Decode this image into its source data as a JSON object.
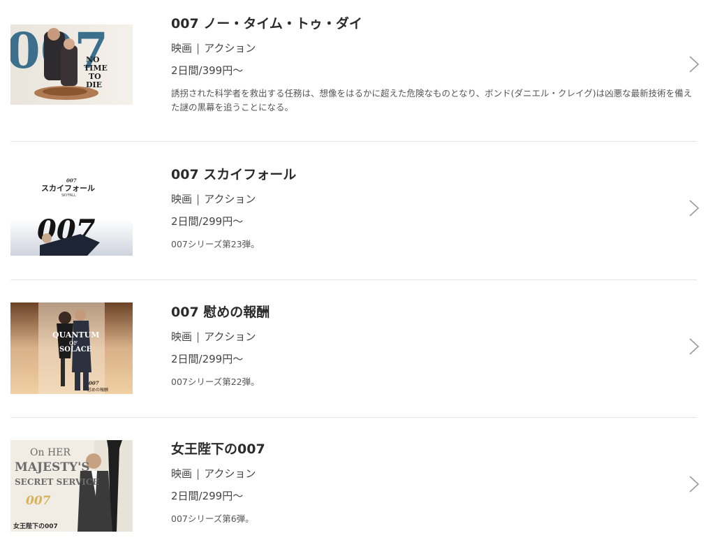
{
  "items": [
    {
      "title": "007 ノー・タイム・トゥ・ダイ",
      "category": "映画",
      "genre": "アクション",
      "price": "2日間/399円〜",
      "description": "誘拐された科学者を救出する任務は、想像をはるかに超えた危険なものとなり、ボンド(ダニエル・クレイグ)は凶悪な最新技術を備えた謎の黒幕を追うことになる。",
      "poster": {
        "logo": "007",
        "text": [
          "NO",
          "TIME",
          "TO",
          "DIE"
        ]
      }
    },
    {
      "title": "007 スカイフォール",
      "category": "映画",
      "genre": "アクション",
      "price": "2日間/299円〜",
      "description": "007シリーズ第23弾。",
      "poster": {
        "logo": "007",
        "small_logo": "007",
        "text_jp": "スカイフォール",
        "text_en": "SKYFALL"
      }
    },
    {
      "title": "007 慰めの報酬",
      "category": "映画",
      "genre": "アクション",
      "price": "2日間/299円〜",
      "description": "007シリーズ第22弾。",
      "poster": {
        "text": [
          "QUANTUM",
          "OF",
          "SOLACE"
        ],
        "logo": "007",
        "text_jp": "慰めの報酬"
      }
    },
    {
      "title": "女王陛下の007",
      "category": "映画",
      "genre": "アクション",
      "price": "2日間/299円〜",
      "description": "007シリーズ第6弾。",
      "poster": {
        "text": [
          "On HER",
          "MAJESTY'S",
          "SECRET SERVICE"
        ],
        "logo": "007",
        "text_jp": "女王陛下の007"
      }
    }
  ],
  "separator": "|",
  "colors": {
    "accent": "#2b2b2b",
    "divider": "#e6e6e6",
    "chevron": "#9a9a9a"
  }
}
